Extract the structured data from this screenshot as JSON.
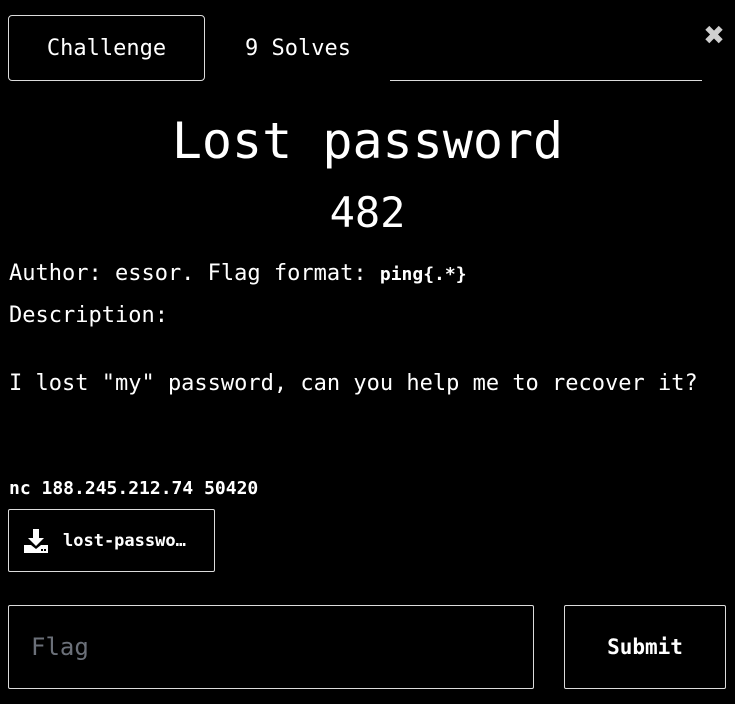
{
  "tabs": {
    "challenge_label": "Challenge",
    "solves_label": "9 Solves"
  },
  "close": {
    "icon": "close-icon",
    "glyph": "✖"
  },
  "challenge": {
    "title": "Lost password",
    "points": "482",
    "author_text": "Author: essor. Flag format: ",
    "flag_format": "ping{.*}",
    "description_heading": "Description:",
    "description": "I lost \"my\" password, can you help me to recover it?",
    "connection": "nc 188.245.212.74 50420"
  },
  "download": {
    "icon": "download-icon",
    "label": "lost-password"
  },
  "flag_form": {
    "placeholder": "Flag",
    "value": "",
    "submit_label": "Submit"
  },
  "colors": {
    "background": "#000000",
    "text": "#ffffff",
    "border": "#dcdcdc",
    "placeholder": "#6b7079"
  }
}
